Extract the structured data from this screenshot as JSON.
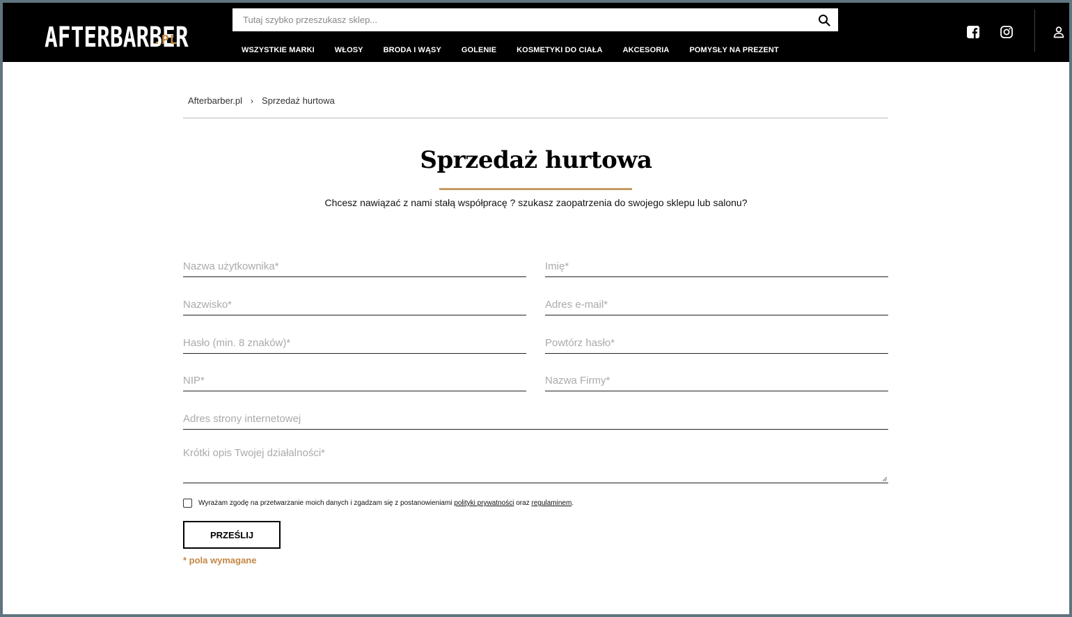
{
  "header": {
    "logo_text": "AFTERBARBER",
    "logo_suffix": ".PL",
    "search_placeholder": "Tutaj szybko przeszukasz sklep...",
    "nav": [
      "WSZYSTKIE MARKI",
      "WŁOSY",
      "BRODA I WĄSY",
      "GOLENIE",
      "KOSMETYKI DO CIAŁA",
      "AKCESORIA",
      "POMYSŁY NA PREZENT"
    ]
  },
  "breadcrumb": {
    "home": "Afterbarber.pl",
    "separator": "›",
    "current": "Sprzedaż hurtowa"
  },
  "page": {
    "title": "Sprzedaż hurtowa",
    "subtitle": "Chcesz nawiązać z nami stałą współpracę ? szukasz zaopatrzenia do swojego sklepu lub salonu?"
  },
  "form": {
    "username_placeholder": "Nazwa użytkownika*",
    "first_name_placeholder": "Imię*",
    "last_name_placeholder": "Nazwisko*",
    "email_placeholder": "Adres e-mail*",
    "password_placeholder": "Hasło (min. 8 znaków)*",
    "password_repeat_placeholder": "Powtórz hasło*",
    "nip_placeholder": "NIP*",
    "company_placeholder": "Nazwa Firmy*",
    "website_placeholder": "Adres strony internetowej",
    "description_placeholder": "Krótki opis Twojej działalności*",
    "consent_prefix": "Wyrażam zgodę na przetwarzanie moich danych i zgadzam się z postanowieniami",
    "consent_privacy_link": "polityki prywatności",
    "consent_and": "oraz",
    "consent_terms_link": "regulaminem",
    "consent_suffix": ".",
    "submit_label": "PRZEŚLIJ",
    "required_note": "* pola wymagane"
  },
  "colors": {
    "accent": "#c49a62",
    "required": "#c48645",
    "header_bg": "#000000"
  }
}
